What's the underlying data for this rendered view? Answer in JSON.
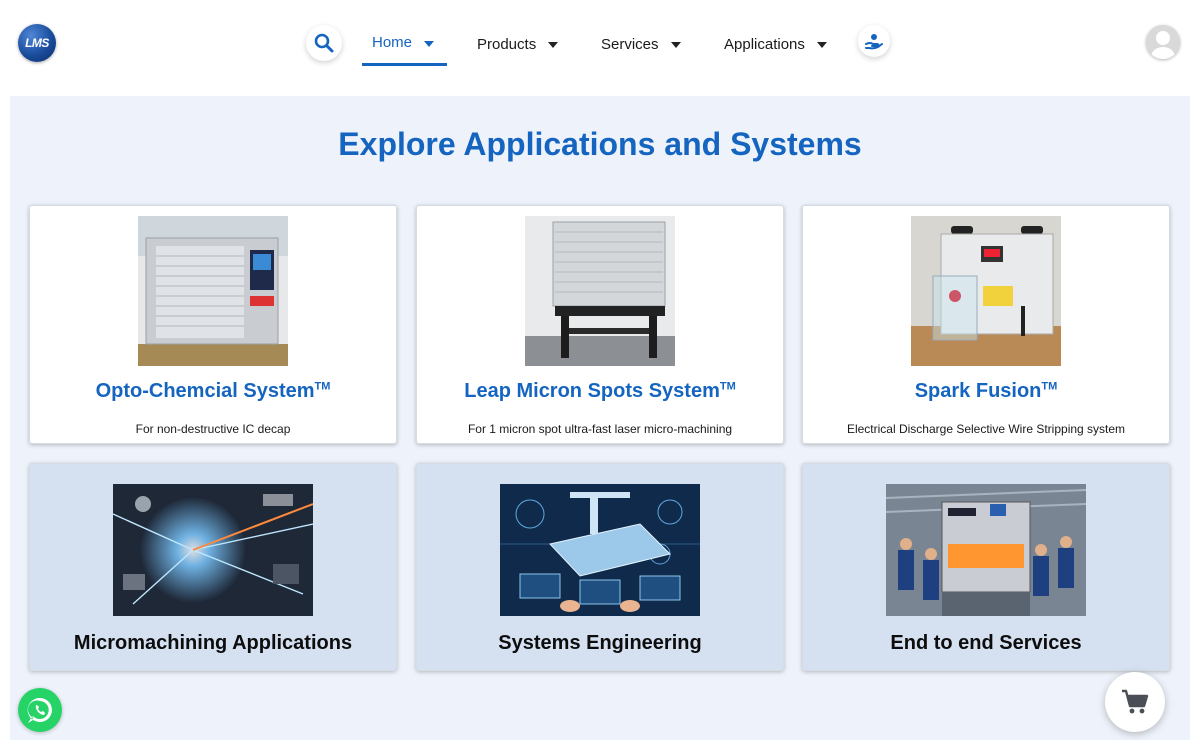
{
  "header": {
    "logo_text": "LMS",
    "nav": [
      {
        "label": "Home",
        "active": true
      },
      {
        "label": "Products"
      },
      {
        "label": "Services"
      },
      {
        "label": "Applications"
      }
    ],
    "icons": {
      "search": "search-icon",
      "help": "hand-help-icon",
      "user": "user-avatar-icon"
    }
  },
  "main": {
    "title": "Explore Applications and Systems",
    "systems": [
      {
        "name": "Opto-Chemcial System",
        "tm": "TM",
        "desc": "For non-destructive IC decap"
      },
      {
        "name": "Leap Micron Spots System",
        "tm": "TM",
        "desc": "For 1 micron spot ultra-fast laser micro-machining"
      },
      {
        "name": "Spark Fusion",
        "tm": "TM",
        "desc": "Electrical Discharge Selective Wire Stripping system"
      }
    ],
    "categories": [
      {
        "name": "Micromachining Applications"
      },
      {
        "name": "Systems Engineering"
      },
      {
        "name": "End to end Services"
      }
    ]
  },
  "floating": {
    "whatsapp": "whatsapp-icon",
    "cart": "cart-icon"
  },
  "colors": {
    "accent": "#1565c0",
    "bg": "#eef3fb",
    "category_card": "#d5e1f1",
    "whatsapp": "#25d366"
  }
}
